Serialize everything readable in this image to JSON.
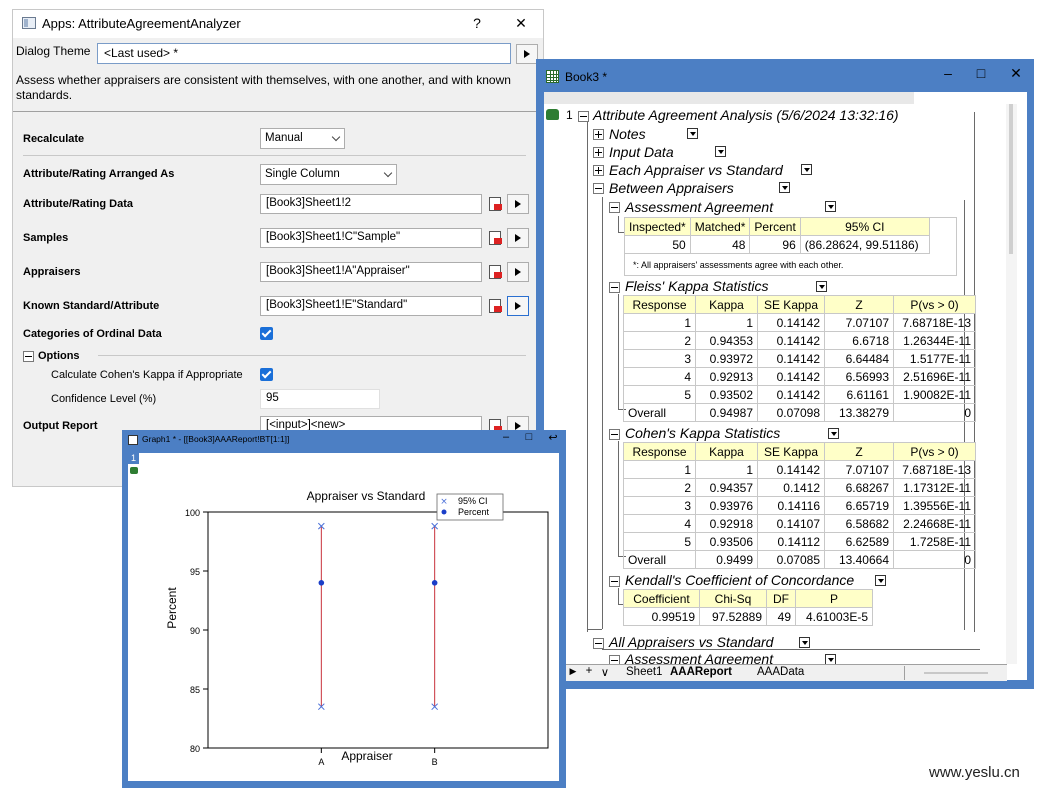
{
  "dialog": {
    "title": "Apps: AttributeAgreementAnalyzer",
    "help_btn": "?",
    "close_btn": "✕",
    "theme_label": "Dialog Theme",
    "theme_value": "<Last used> *",
    "description": "Assess whether appraisers are consistent with themselves, with one another, and with known standards.",
    "recalculate_label": "Recalculate",
    "recalculate_value": "Manual",
    "arranged_label": "Attribute/Rating Arranged As",
    "arranged_value": "Single Column",
    "data_label": "Attribute/Rating Data",
    "data_value": "[Book3]Sheet1!2",
    "samples_label": "Samples",
    "samples_value": "[Book3]Sheet1!C\"Sample\"",
    "appraisers_label": "Appraisers",
    "appraisers_value": "[Book3]Sheet1!A\"Appraiser\"",
    "standard_label": "Known Standard/Attribute",
    "standard_value": "[Book3]Sheet1!E\"Standard\"",
    "ordinal_label": "Categories of Ordinal Data",
    "ordinal_checked": true,
    "options_label": "Options",
    "cohen_label": "Calculate Cohen's Kappa if Appropriate",
    "cohen_checked": true,
    "confidence_label": "Confidence Level (%)",
    "confidence_value": "95",
    "output_label": "Output Report",
    "output_value": "[<input>]<new>"
  },
  "workbook": {
    "title": "Book3 *",
    "minimize": "–",
    "maximize": "□",
    "close": "✕",
    "root_number": "1",
    "root_title": "Attribute Agreement Analysis (5/6/2024 13:32:16)",
    "nodes": {
      "notes": "Notes",
      "input_data": "Input Data",
      "each_vs_std": "Each Appraiser vs Standard",
      "between": "Between Appraisers",
      "assessment": "Assessment Agreement",
      "fleiss": "Fleiss' Kappa Statistics",
      "cohen": "Cohen's Kappa Statistics",
      "kendall": "Kendall's Coefficient of Concordance",
      "all_vs_std": "All Appraisers vs Standard",
      "assessment2": "Assessment Agreement"
    },
    "assessment_table": {
      "headers": [
        "Inspected*",
        "Matched*",
        "Percent",
        "95% CI"
      ],
      "row": [
        "50",
        "48",
        "96",
        "(86.28624, 99.51186)"
      ],
      "note": "*: All appraisers' assessments agree with each other."
    },
    "fleiss_table": {
      "headers": [
        "Response",
        "Kappa",
        "SE Kappa",
        "Z",
        "P(vs > 0)"
      ],
      "rows": [
        [
          "1",
          "1",
          "0.14142",
          "7.07107",
          "7.68718E-13"
        ],
        [
          "2",
          "0.94353",
          "0.14142",
          "6.6718",
          "1.26344E-11"
        ],
        [
          "3",
          "0.93972",
          "0.14142",
          "6.64484",
          "1.5177E-11"
        ],
        [
          "4",
          "0.92913",
          "0.14142",
          "6.56993",
          "2.51696E-11"
        ],
        [
          "5",
          "0.93502",
          "0.14142",
          "6.61161",
          "1.90082E-11"
        ],
        [
          "Overall",
          "0.94987",
          "0.07098",
          "13.38279",
          "0"
        ]
      ]
    },
    "cohen_table": {
      "headers": [
        "Response",
        "Kappa",
        "SE Kappa",
        "Z",
        "P(vs > 0)"
      ],
      "rows": [
        [
          "1",
          "1",
          "0.14142",
          "7.07107",
          "7.68718E-13"
        ],
        [
          "2",
          "0.94357",
          "0.1412",
          "6.68267",
          "1.17312E-11"
        ],
        [
          "3",
          "0.93976",
          "0.14116",
          "6.65719",
          "1.39556E-11"
        ],
        [
          "4",
          "0.92918",
          "0.14107",
          "6.58682",
          "2.24668E-11"
        ],
        [
          "5",
          "0.93506",
          "0.14112",
          "6.62589",
          "1.7258E-11"
        ],
        [
          "Overall",
          "0.9499",
          "0.07085",
          "13.40664",
          "0"
        ]
      ]
    },
    "kendall_table": {
      "headers": [
        "Coefficient",
        "Chi-Sq",
        "DF",
        "P"
      ],
      "row": [
        "0.99519",
        "97.52889",
        "49",
        "4.61003E-5"
      ]
    },
    "sheet_nav": [
      "▶",
      "+",
      "∨"
    ],
    "sheets": [
      "Sheet1",
      "AAAReport",
      "AAAData"
    ]
  },
  "graph": {
    "title": "Graph1 * - [[Book3]AAAReport!BT[1:1]]",
    "minimize": "–",
    "maximize": "□",
    "restore": "↩",
    "layer": "1"
  },
  "chart_data": {
    "type": "scatter",
    "title": "Appraiser vs Standard",
    "xlabel": "Appraiser",
    "ylabel": "Percent",
    "categories": [
      "A",
      "B"
    ],
    "ylim": [
      80,
      100
    ],
    "yticks": [
      "80",
      "85",
      "90",
      "95",
      "100"
    ],
    "series": [
      {
        "name": "95% CI",
        "lower": [
          83.5,
          83.5
        ],
        "upper": [
          98.8,
          98.8
        ],
        "color": "#4a6fd8"
      },
      {
        "name": "Percent",
        "values": [
          94,
          94
        ],
        "color": "#1a3ec8"
      }
    ],
    "ci_line_color": "#c8323c",
    "legend_position": "top-right"
  },
  "watermark": "www.yeslu.cn"
}
